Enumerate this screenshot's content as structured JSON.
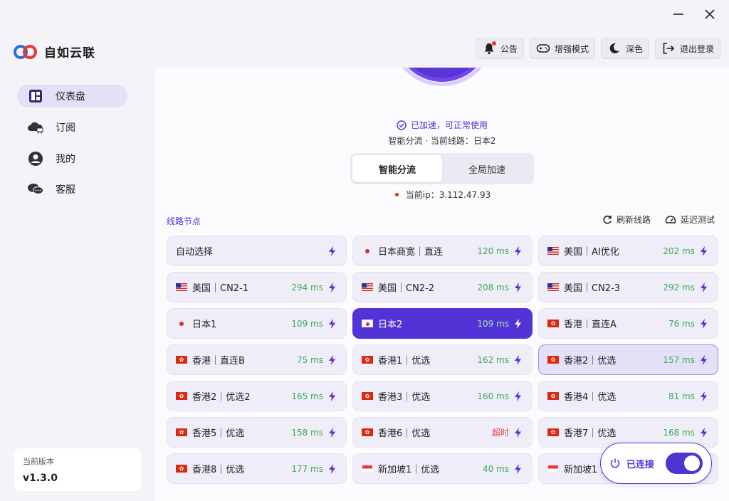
{
  "app": {
    "name": "自如云联"
  },
  "header": {
    "buttons": [
      {
        "label": "公告",
        "icon": "bell-icon"
      },
      {
        "label": "增强模式",
        "icon": "gamepad-icon"
      },
      {
        "label": "深色",
        "icon": "moon-icon"
      },
      {
        "label": "退出登录",
        "icon": "logout-icon"
      }
    ]
  },
  "sidebar": {
    "items": [
      {
        "label": "仪表盘",
        "icon": "dashboard-icon",
        "active": true
      },
      {
        "label": "订阅",
        "icon": "cloud-cart-icon"
      },
      {
        "label": "我的",
        "icon": "user-icon"
      },
      {
        "label": "客服",
        "icon": "chat-icon"
      }
    ],
    "version_label": "当前版本",
    "version_value": "v1.3.0"
  },
  "status": {
    "text": "已加速，可正常使用",
    "detail": "智能分流 · 当前线路：日本2",
    "modes": [
      "智能分流",
      "全局加速"
    ],
    "active_mode": "智能分流",
    "ip": "当前ip：3.112.47.93"
  },
  "nodes_section": {
    "title": "线路节点",
    "refresh": "刷新线路",
    "latency_test": "延迟测试"
  },
  "nodes": [
    {
      "name": "自动选择",
      "flag": "none",
      "latency": ""
    },
    {
      "name": "日本商宽｜直连",
      "flag": "jp-dot",
      "latency": "120 ms"
    },
    {
      "name": "美国｜AI优化",
      "flag": "us",
      "latency": "202 ms"
    },
    {
      "name": "美国｜CN2-1",
      "flag": "us",
      "latency": "294 ms"
    },
    {
      "name": "美国｜CN2-2",
      "flag": "us",
      "latency": "208 ms"
    },
    {
      "name": "美国｜CN2-3",
      "flag": "us",
      "latency": "292 ms"
    },
    {
      "name": "日本1",
      "flag": "jp-dot",
      "latency": "109 ms"
    },
    {
      "name": "日本2",
      "flag": "jp",
      "latency": "109 ms",
      "selected": true
    },
    {
      "name": "香港｜直连A",
      "flag": "hk",
      "latency": "76 ms"
    },
    {
      "name": "香港｜直连B",
      "flag": "hk",
      "latency": "75 ms"
    },
    {
      "name": "香港1｜优选",
      "flag": "hk",
      "latency": "162 ms"
    },
    {
      "name": "香港2｜优选",
      "flag": "hk",
      "latency": "157 ms",
      "hovered": true
    },
    {
      "name": "香港2｜优选2",
      "flag": "hk",
      "latency": "165 ms"
    },
    {
      "name": "香港3｜优选",
      "flag": "hk",
      "latency": "160 ms"
    },
    {
      "name": "香港4｜优选",
      "flag": "hk",
      "latency": "81 ms"
    },
    {
      "name": "香港5｜优选",
      "flag": "hk",
      "latency": "158 ms"
    },
    {
      "name": "香港6｜优选",
      "flag": "hk",
      "latency": "超时",
      "timeout": true
    },
    {
      "name": "香港7｜优选",
      "flag": "hk",
      "latency": "168 ms"
    },
    {
      "name": "香港8｜优选",
      "flag": "hk",
      "latency": "177 ms"
    },
    {
      "name": "新加坡1｜优选",
      "flag": "sg",
      "latency": "40 ms"
    },
    {
      "name": "新加坡1｜",
      "flag": "sg",
      "latency": ""
    }
  ],
  "connection": {
    "label": "已连接",
    "on": true
  },
  "colors": {
    "accent": "#5233d6",
    "latency_ok": "#3daa57",
    "latency_timeout": "#e0423b"
  }
}
